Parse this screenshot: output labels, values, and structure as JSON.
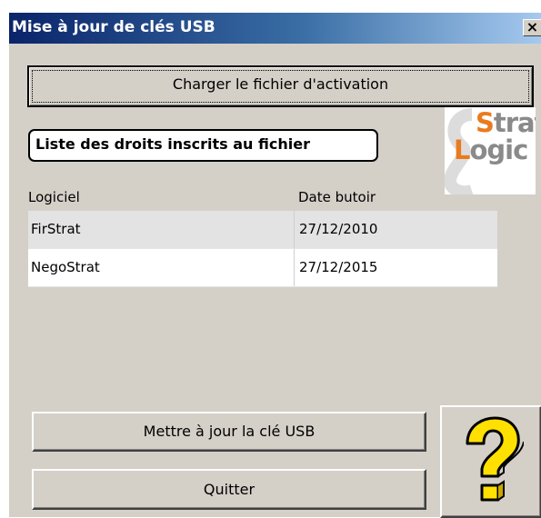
{
  "window": {
    "title": "Mise à jour de clés USB",
    "close_glyph": "✕"
  },
  "buttons": {
    "load_file": "Charger le fichier d'activation",
    "update_key": "Mettre à jour la clé USB",
    "quit": "Quitter",
    "help_icon": "question-mark-icon"
  },
  "rights_label": "Liste des droits inscrits au fichier",
  "logo": {
    "line1_accent": "S",
    "line1_rest": "trat",
    "line2_accent": "L",
    "line2_rest": "ogic",
    "accent_color": "#e97b1e",
    "text_color": "#8a8a8a"
  },
  "table": {
    "columns": [
      "Logiciel",
      "Date butoir"
    ],
    "rows": [
      [
        "FirStrat",
        "27/12/2010"
      ],
      [
        "NegoStrat",
        "27/12/2015"
      ]
    ]
  },
  "colors": {
    "dialog_bg": "#d4d0c8",
    "title_gradient_start": "#0a246a",
    "title_gradient_end": "#a6caf0",
    "help_icon_fill": "#ffe000"
  }
}
